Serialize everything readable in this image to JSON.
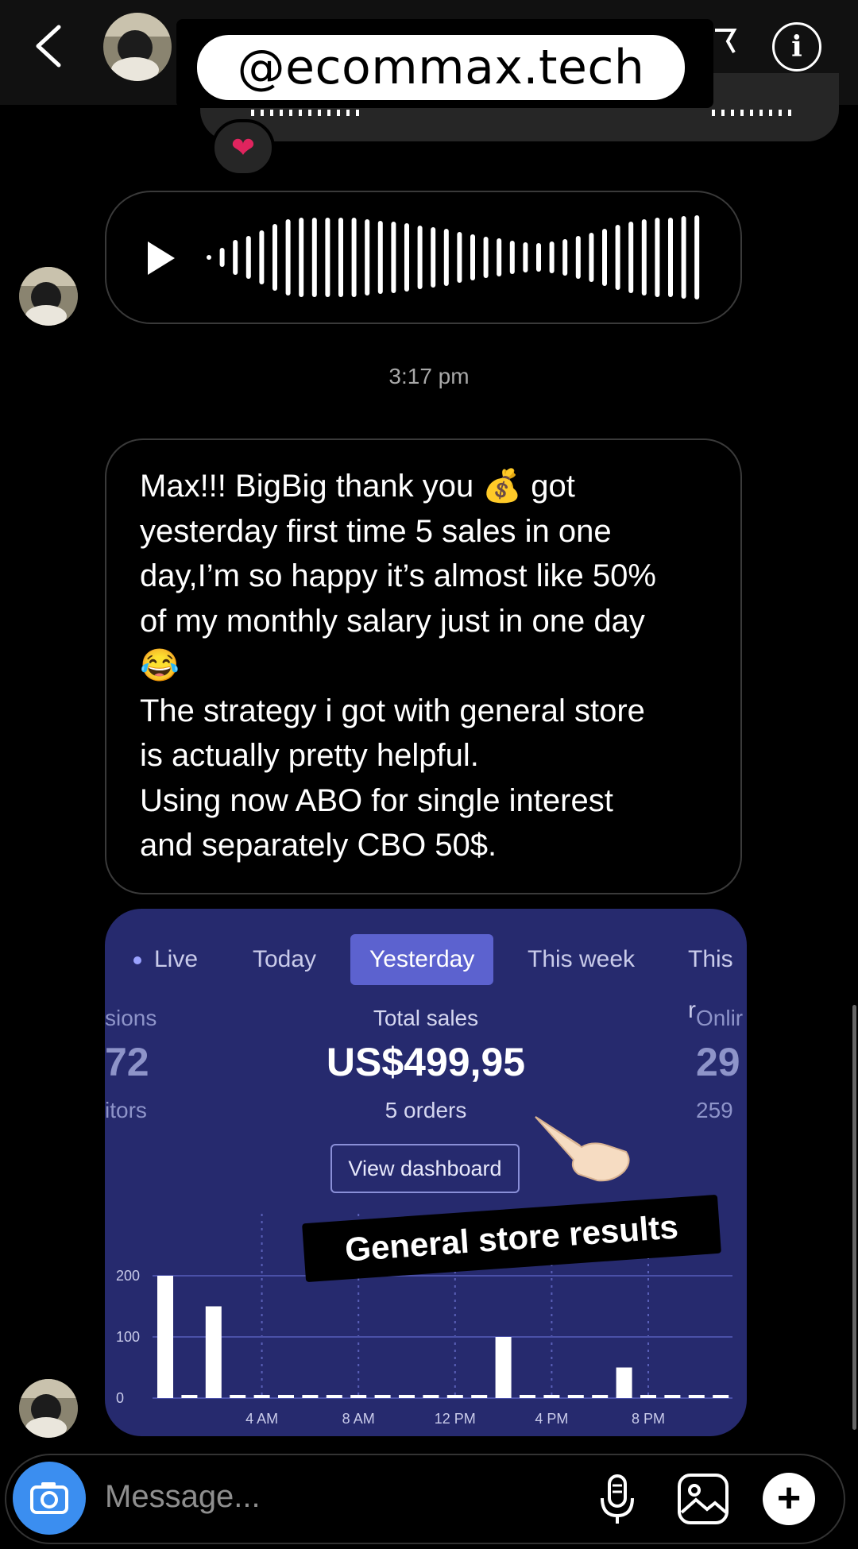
{
  "header": {
    "username": "@ecommax.tech",
    "back_icon": "chevron-left-icon",
    "video_icon": "video-call-icon",
    "info_icon": "info-icon"
  },
  "reaction": {
    "emoji": "❤"
  },
  "timestamp": "3:17 pm",
  "message": {
    "text": "Max!!! BigBig thank you 💰 got\nyesterday first time 5 sales in one\nday,I’m so happy it’s almost like 50%\nof my monthly salary just in one day\n😂\nThe strategy i got with general store\nis actually pretty helpful.\nUsing now ABO for single interest\nand separately CBO 50$."
  },
  "dashboard": {
    "tabs": [
      "Live",
      "Today",
      "Yesterday",
      "This week",
      "This r"
    ],
    "active_tab": "Yesterday",
    "left_stat": {
      "label": "sions",
      "value": "72",
      "sub": "itors"
    },
    "center_stat": {
      "label": "Total sales",
      "value": "US$499,95",
      "sub": "5 orders"
    },
    "right_stat": {
      "label": "Onlir",
      "value": "29",
      "sub": "259"
    },
    "view_button": "View dashboard",
    "sticker": "General store results",
    "colors": {
      "card": "#262a6e",
      "active_tab": "#5c62cf"
    }
  },
  "chart_data": {
    "type": "bar",
    "y_ticks": [
      0,
      100,
      200
    ],
    "ylim": [
      0,
      220
    ],
    "x_tick_labels": [
      "4 AM",
      "8 AM",
      "12 PM",
      "4 PM",
      "8 PM"
    ],
    "categories": [
      "12 AM",
      "1 AM",
      "2 AM",
      "3 AM",
      "4 AM",
      "5 AM",
      "6 AM",
      "7 AM",
      "8 AM",
      "9 AM",
      "10 AM",
      "11 AM",
      "12 PM",
      "1 PM",
      "2 PM",
      "3 PM",
      "4 PM",
      "5 PM",
      "6 PM",
      "7 PM",
      "8 PM",
      "9 PM",
      "10 PM",
      "11 PM"
    ],
    "values": [
      200,
      0,
      150,
      0,
      0,
      0,
      0,
      0,
      0,
      0,
      0,
      0,
      0,
      0,
      100,
      0,
      0,
      0,
      0,
      50,
      0,
      0,
      0,
      0
    ],
    "grid": true
  },
  "composer": {
    "placeholder": "Message...",
    "camera_icon": "camera-icon",
    "mic_icon": "microphone-icon",
    "gallery_icon": "gallery-icon",
    "plus_icon": "plus-icon"
  }
}
